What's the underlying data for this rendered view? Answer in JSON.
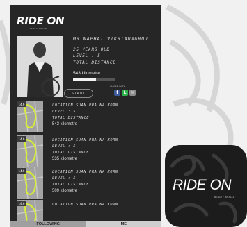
{
  "app": {
    "brand": "RIDE ON",
    "brand_sub": "BEAUTY BICYCLE"
  },
  "profile": {
    "name": "MR.NAPHAT VIKRIAUNGROJ",
    "age": "25 YEARS OLD",
    "level": "LEVEL : 5",
    "total_distance_label": "TOTAL DISTANCE",
    "total_distance": "543 kilometre",
    "progress_fraction": 0.55
  },
  "actions": {
    "start_label": "START",
    "share_label": "SHARE WITH",
    "share_icons": [
      {
        "name": "facebook-icon",
        "glyph": "f",
        "color": "#3b5998"
      },
      {
        "name": "line-icon",
        "glyph": "L",
        "color": "#2fb24c"
      },
      {
        "name": "email-icon",
        "glyph": "✉",
        "color": "#8c8c8c"
      }
    ]
  },
  "history": [
    {
      "location": "LOCATION SUAN PRA NA KORN",
      "level": "LEVEL : 5",
      "distance_label": "TOTAL DISTANCE",
      "distance": "543 kilometre",
      "badge": "14.6"
    },
    {
      "location": "LOCATION SUAN PRA NA KORN",
      "level": "LEVEL : 5",
      "distance_label": "TOTAL DISTANCE",
      "distance": "535 kilometre",
      "badge": "14.6"
    },
    {
      "location": "LOCATION SUAN PRA NA KORN",
      "level": "LEVEL : 5",
      "distance_label": "TOTAL DISTANCE",
      "distance": "509 kilometre",
      "badge": "14.6"
    },
    {
      "location": "LOCATION SUAN PRA NA KORN",
      "level": "",
      "distance_label": "",
      "distance": "",
      "badge": "14.6"
    }
  ],
  "tabs": [
    {
      "label": "FOLLOWING",
      "active": true
    },
    {
      "label": "ME",
      "active": false
    }
  ],
  "app_icon": {
    "brand": "RIDE ON",
    "sub": "BEAUTY BICYCLE"
  },
  "colors": {
    "phone_bg": "#262626",
    "route_highlight": "#d7ec3a"
  }
}
